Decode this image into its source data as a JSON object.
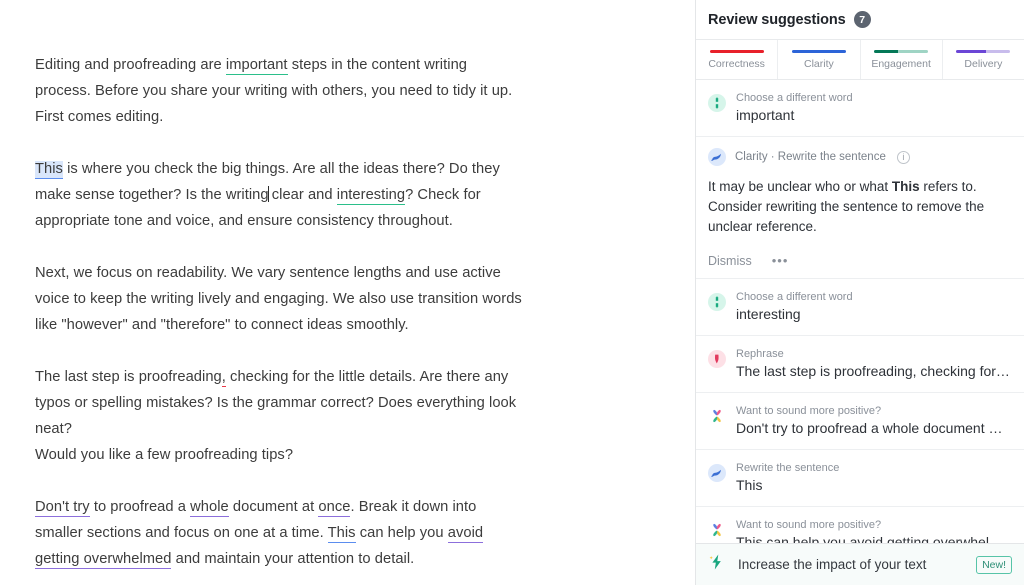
{
  "document": {
    "paragraphs": [
      {
        "id": "p1",
        "runs": [
          {
            "t": "Editing and proofreading are ",
            "s": "plain"
          },
          {
            "t": "important",
            "s": "u-green"
          },
          {
            "t": " steps in the content writing process. Before you share your writing with others, you need to tidy it up. First comes editing.",
            "s": "plain"
          }
        ]
      },
      {
        "id": "p2",
        "runs": [
          {
            "t": "This",
            "s": "hl-blue"
          },
          {
            "t": " is where you check the big things. Are all the ideas there? Do they make sense together? Is the writing",
            "s": "plain"
          },
          {
            "t": "",
            "s": "caret"
          },
          {
            "t": " clear and ",
            "s": "plain"
          },
          {
            "t": "interesting",
            "s": "u-green"
          },
          {
            "t": "? Check for appropriate tone and voice, and ensure consistency throughout.",
            "s": "plain"
          }
        ]
      },
      {
        "id": "p3",
        "runs": [
          {
            "t": "Next, we focus on readability. We vary sentence lengths and use active voice to keep the writing lively and engaging. We also use transition words like \"however\" and \"therefore\" to connect ideas smoothly.",
            "s": "plain"
          }
        ]
      },
      {
        "id": "p4",
        "runs": [
          {
            "t": "The last step is proofreading",
            "s": "plain"
          },
          {
            "t": ",",
            "s": "u-red"
          },
          {
            "t": " checking for the little details. Are there any typos or spelling mistakes? Is the grammar correct? Does everything look neat?",
            "s": "plain"
          }
        ]
      },
      {
        "id": "p5",
        "runs": [
          {
            "t": "Would you like a few proofreading tips?",
            "s": "plain"
          }
        ]
      },
      {
        "id": "p6",
        "runs": [
          {
            "t": "Don't try",
            "s": "u-purple"
          },
          {
            "t": " to proofread a ",
            "s": "plain"
          },
          {
            "t": "whole",
            "s": "u-purple"
          },
          {
            "t": " document at ",
            "s": "plain"
          },
          {
            "t": "once",
            "s": "u-purple"
          },
          {
            "t": ". Break it down into smaller sections and focus on one at a time. ",
            "s": "plain"
          },
          {
            "t": "This",
            "s": "u-blue"
          },
          {
            "t": " can help you ",
            "s": "plain"
          },
          {
            "t": "avoid",
            "s": "u-purple"
          },
          {
            "t": " ",
            "s": "plain"
          },
          {
            "t": "getting overwhelmed",
            "s": "u-purple"
          },
          {
            "t": " and maintain your attention to detail.",
            "s": "plain"
          }
        ]
      }
    ]
  },
  "sidebar": {
    "header": {
      "title": "Review suggestions",
      "badge_count": "7"
    },
    "tabs": [
      {
        "label": "Correctness",
        "color": "#e8202a",
        "fill_percent": 100,
        "rest_color": "#f3b9bc"
      },
      {
        "label": "Clarity",
        "color": "#2c64d8",
        "fill_percent": 100,
        "rest_color": "#b9cbf0"
      },
      {
        "label": "Engagement",
        "color": "#047857",
        "fill_percent": 45,
        "rest_color": "#9fd4c4"
      },
      {
        "label": "Delivery",
        "color": "#6b46d6",
        "fill_percent": 55,
        "rest_color": "#c8bcec"
      }
    ],
    "suggestions": [
      {
        "kind": "compact",
        "icon": "synonym-icon",
        "kicker": "Choose a different word",
        "main": "important"
      },
      {
        "kind": "expanded",
        "icon": "clarity-icon",
        "category": "Clarity · Rewrite the sentence",
        "info_glyph": "i",
        "body_pre": "It may be unclear who or what ",
        "body_bold": "This",
        "body_post": " refers to. Consider rewriting the sentence to remove the unclear reference.",
        "dismiss_label": "Dismiss",
        "more_label": "•••"
      },
      {
        "kind": "compact",
        "icon": "synonym-icon",
        "kicker": "Choose a different word",
        "main": "interesting"
      },
      {
        "kind": "compact",
        "icon": "rephrase-icon",
        "kicker": "Rephrase",
        "main": "The last step is proofreading, checking for the littl..."
      },
      {
        "kind": "compact",
        "icon": "tone-pinwheel-icon",
        "kicker": "Want to sound more positive?",
        "main": "Don't try to proofread a whole document at once."
      },
      {
        "kind": "compact",
        "icon": "clarity-icon",
        "kicker": "Rewrite the sentence",
        "main": "This"
      },
      {
        "kind": "compact",
        "icon": "tone-pinwheel-icon",
        "kicker": "Want to sound more positive?",
        "main": "This can help you avoid getting overwhelmed and..."
      }
    ],
    "footer": {
      "icon": "lightning-bolt-icon",
      "label": "Increase the impact of your text",
      "badge": "New!"
    }
  }
}
